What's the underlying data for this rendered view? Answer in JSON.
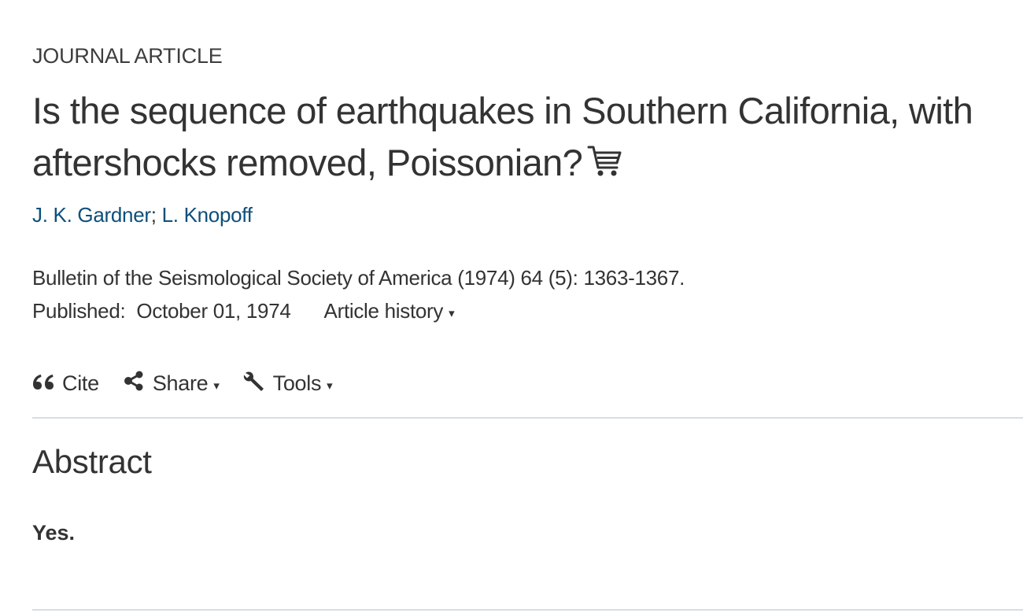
{
  "article": {
    "type_label": "JOURNAL ARTICLE",
    "title": "Is the sequence of earthquakes in Southern California, with aftershocks removed, Poissonian?",
    "cart_icon": "shopping-cart-icon",
    "authors": [
      {
        "name": "J. K. Gardner"
      },
      {
        "name": "L. Knopoff"
      }
    ],
    "author_separator": ";",
    "citation": "Bulletin of the Seismological Society of America (1974) 64 (5): 1363-1367.",
    "published_label": "Published:",
    "published_date": "October 01, 1974",
    "history_label": "Article history",
    "caret": "▾"
  },
  "toolbar": {
    "cite_label": "Cite",
    "cite_icon": "quote-icon",
    "share_label": "Share",
    "share_icon": "share-icon",
    "tools_label": "Tools",
    "tools_icon": "wrench-icon",
    "caret": "▾"
  },
  "abstract": {
    "heading": "Abstract",
    "body": "Yes."
  },
  "colors": {
    "text": "#333333",
    "link": "#0d4f7a",
    "divider": "#d6dee5"
  }
}
